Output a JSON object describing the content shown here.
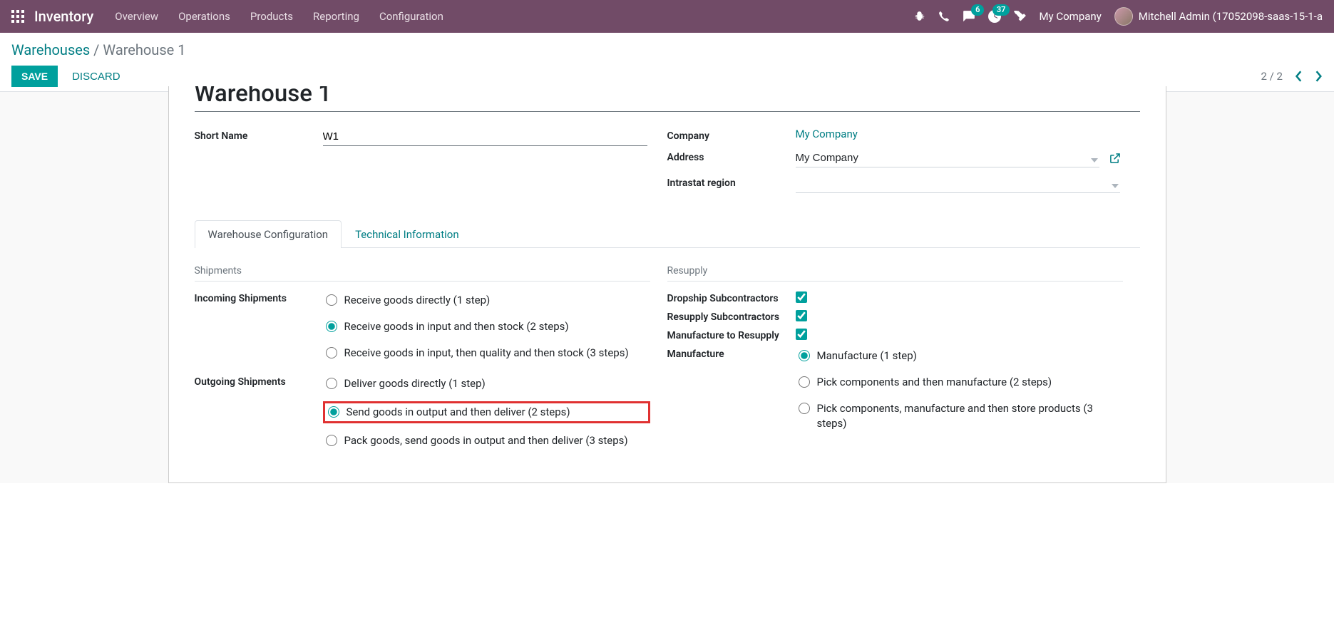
{
  "navbar": {
    "brand": "Inventory",
    "menu": [
      "Overview",
      "Operations",
      "Products",
      "Reporting",
      "Configuration"
    ],
    "messaging_badge": "6",
    "activities_badge": "37",
    "company": "My Company",
    "user": "Mitchell Admin (17052098-saas-15-1-a"
  },
  "breadcrumb": {
    "parent": "Warehouses",
    "current": "Warehouse 1"
  },
  "buttons": {
    "save": "SAVE",
    "discard": "DISCARD"
  },
  "pager": {
    "value": "2 / 2"
  },
  "record": {
    "title": "Warehouse 1",
    "short_name_label": "Short Name",
    "short_name": "W1",
    "company_label": "Company",
    "company": "My Company",
    "address_label": "Address",
    "address": "My Company",
    "intrastat_label": "Intrastat region",
    "intrastat": ""
  },
  "tabs": {
    "config": "Warehouse Configuration",
    "technical": "Technical Information"
  },
  "shipments": {
    "title": "Shipments",
    "incoming_label": "Incoming Shipments",
    "incoming_opts": [
      "Receive goods directly (1 step)",
      "Receive goods in input and then stock (2 steps)",
      "Receive goods in input, then quality and then stock (3 steps)"
    ],
    "incoming_selected": 1,
    "outgoing_label": "Outgoing Shipments",
    "outgoing_opts": [
      "Deliver goods directly (1 step)",
      "Send goods in output and then deliver (2 steps)",
      "Pack goods, send goods in output and then deliver (3 steps)"
    ],
    "outgoing_selected": 1
  },
  "resupply": {
    "title": "Resupply",
    "dropship_label": "Dropship Subcontractors",
    "dropship": true,
    "resupply_sub_label": "Resupply Subcontractors",
    "resupply_sub": true,
    "manu_resupply_label": "Manufacture to Resupply",
    "manu_resupply": true,
    "manufacture_label": "Manufacture",
    "manufacture_opts": [
      "Manufacture (1 step)",
      "Pick components and then manufacture (2 steps)",
      "Pick components, manufacture and then store products (3 steps)"
    ],
    "manufacture_selected": 0
  }
}
